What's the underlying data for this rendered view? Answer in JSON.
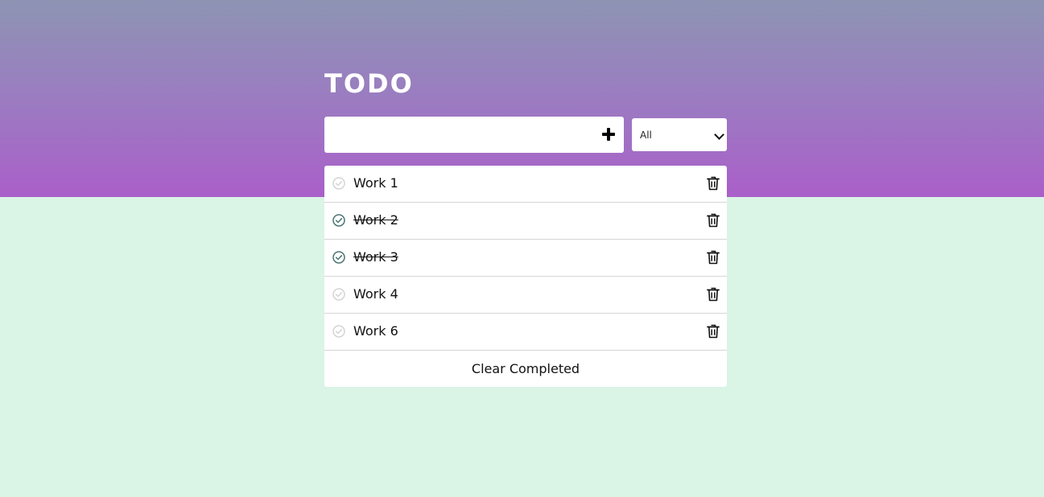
{
  "header": {
    "title": "TODO"
  },
  "new_todo": {
    "value": "",
    "placeholder": "",
    "add_icon": "plus-icon"
  },
  "filter": {
    "selected": "All"
  },
  "todos": [
    {
      "label": "Work 1",
      "completed": false
    },
    {
      "label": "Work 2",
      "completed": true
    },
    {
      "label": "Work 3",
      "completed": true
    },
    {
      "label": "Work 4",
      "completed": false
    },
    {
      "label": "Work 6",
      "completed": false
    }
  ],
  "footer": {
    "clear_label": "Clear Completed"
  },
  "colors": {
    "gradient_top": "#8d94b3",
    "gradient_bottom": "#aa5fc9",
    "page_background": "#daf4e6",
    "check_done": "#4a7573",
    "check_pending": "#d4d4d4"
  },
  "icons": {
    "check": "check-circle-icon",
    "delete": "trash-icon",
    "select": "chevron-down-icon"
  }
}
